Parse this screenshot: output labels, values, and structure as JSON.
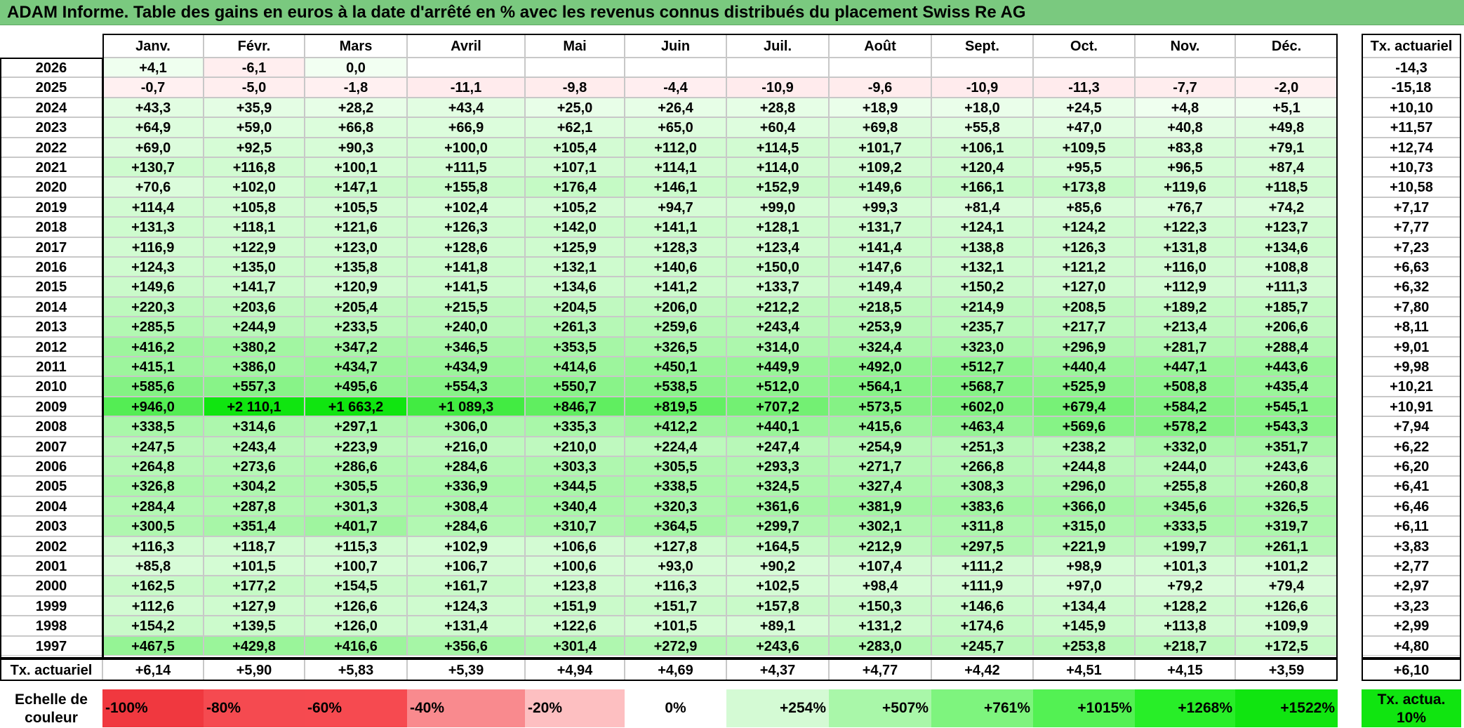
{
  "title": "ADAM Informe. Table des gains en euros à la date d'arrêté en % avec les revenus connus distribués du placement Swiss Re AG",
  "months": [
    "Janv.",
    "Févr.",
    "Mars",
    "Avril",
    "Mai",
    "Juin",
    "Juil.",
    "Août",
    "Sept.",
    "Oct.",
    "Nov.",
    "Déc."
  ],
  "rate_header": "Tx. actuariel",
  "rows": [
    {
      "year": "2026",
      "values": [
        "+4,1",
        "-6,1",
        "0,0",
        "",
        "",
        "",
        "",
        "",
        "",
        "",
        "",
        ""
      ],
      "rate": "-14,3"
    },
    {
      "year": "2025",
      "values": [
        "-0,7",
        "-5,0",
        "-1,8",
        "-11,1",
        "-9,8",
        "-4,4",
        "-10,9",
        "-9,6",
        "-10,9",
        "-11,3",
        "-7,7",
        "-2,0"
      ],
      "rate": "-15,18"
    },
    {
      "year": "2024",
      "values": [
        "+43,3",
        "+35,9",
        "+28,2",
        "+43,4",
        "+25,0",
        "+26,4",
        "+28,8",
        "+18,9",
        "+18,0",
        "+24,5",
        "+4,8",
        "+5,1"
      ],
      "rate": "+10,10"
    },
    {
      "year": "2023",
      "values": [
        "+64,9",
        "+59,0",
        "+66,8",
        "+66,9",
        "+62,1",
        "+65,0",
        "+60,4",
        "+69,8",
        "+55,8",
        "+47,0",
        "+40,8",
        "+49,8"
      ],
      "rate": "+11,57"
    },
    {
      "year": "2022",
      "values": [
        "+69,0",
        "+92,5",
        "+90,3",
        "+100,0",
        "+105,4",
        "+112,0",
        "+114,5",
        "+101,7",
        "+106,1",
        "+109,5",
        "+83,8",
        "+79,1"
      ],
      "rate": "+12,74"
    },
    {
      "year": "2021",
      "values": [
        "+130,7",
        "+116,8",
        "+100,1",
        "+111,5",
        "+107,1",
        "+114,1",
        "+114,0",
        "+109,2",
        "+120,4",
        "+95,5",
        "+96,5",
        "+87,4"
      ],
      "rate": "+10,73"
    },
    {
      "year": "2020",
      "values": [
        "+70,6",
        "+102,0",
        "+147,1",
        "+155,8",
        "+176,4",
        "+146,1",
        "+152,9",
        "+149,6",
        "+166,1",
        "+173,8",
        "+119,6",
        "+118,5"
      ],
      "rate": "+10,58"
    },
    {
      "year": "2019",
      "values": [
        "+114,4",
        "+105,8",
        "+105,5",
        "+102,4",
        "+105,2",
        "+94,7",
        "+99,0",
        "+99,3",
        "+81,4",
        "+85,6",
        "+76,7",
        "+74,2"
      ],
      "rate": "+7,17"
    },
    {
      "year": "2018",
      "values": [
        "+131,3",
        "+118,1",
        "+121,6",
        "+126,3",
        "+142,0",
        "+141,1",
        "+128,1",
        "+131,7",
        "+124,1",
        "+124,2",
        "+122,3",
        "+123,7"
      ],
      "rate": "+7,77"
    },
    {
      "year": "2017",
      "values": [
        "+116,9",
        "+122,9",
        "+123,0",
        "+128,6",
        "+125,9",
        "+128,3",
        "+123,4",
        "+141,4",
        "+138,8",
        "+126,3",
        "+131,8",
        "+134,6"
      ],
      "rate": "+7,23"
    },
    {
      "year": "2016",
      "values": [
        "+124,3",
        "+135,0",
        "+135,8",
        "+141,8",
        "+132,1",
        "+140,6",
        "+150,0",
        "+147,6",
        "+132,1",
        "+121,2",
        "+116,0",
        "+108,8"
      ],
      "rate": "+6,63"
    },
    {
      "year": "2015",
      "values": [
        "+149,6",
        "+141,7",
        "+120,9",
        "+141,5",
        "+134,6",
        "+141,2",
        "+133,7",
        "+149,4",
        "+150,2",
        "+127,0",
        "+112,9",
        "+111,3"
      ],
      "rate": "+6,32"
    },
    {
      "year": "2014",
      "values": [
        "+220,3",
        "+203,6",
        "+205,4",
        "+215,5",
        "+204,5",
        "+206,0",
        "+212,2",
        "+218,5",
        "+214,9",
        "+208,5",
        "+189,2",
        "+185,7"
      ],
      "rate": "+7,80"
    },
    {
      "year": "2013",
      "values": [
        "+285,5",
        "+244,9",
        "+233,5",
        "+240,0",
        "+261,3",
        "+259,6",
        "+243,4",
        "+253,9",
        "+235,7",
        "+217,7",
        "+213,4",
        "+206,6"
      ],
      "rate": "+8,11"
    },
    {
      "year": "2012",
      "values": [
        "+416,2",
        "+380,2",
        "+347,2",
        "+346,5",
        "+353,5",
        "+326,5",
        "+314,0",
        "+324,4",
        "+323,0",
        "+296,9",
        "+281,7",
        "+288,4"
      ],
      "rate": "+9,01"
    },
    {
      "year": "2011",
      "values": [
        "+415,1",
        "+386,0",
        "+434,7",
        "+434,9",
        "+414,6",
        "+450,1",
        "+449,9",
        "+492,0",
        "+512,7",
        "+440,4",
        "+447,1",
        "+443,6"
      ],
      "rate": "+9,98"
    },
    {
      "year": "2010",
      "values": [
        "+585,6",
        "+557,3",
        "+495,6",
        "+554,3",
        "+550,7",
        "+538,5",
        "+512,0",
        "+564,1",
        "+568,7",
        "+525,9",
        "+508,8",
        "+435,4"
      ],
      "rate": "+10,21"
    },
    {
      "year": "2009",
      "values": [
        "+946,0",
        "+2 110,1",
        "+1 663,2",
        "+1 089,3",
        "+846,7",
        "+819,5",
        "+707,2",
        "+573,5",
        "+602,0",
        "+679,4",
        "+584,2",
        "+545,1"
      ],
      "rate": "+10,91"
    },
    {
      "year": "2008",
      "values": [
        "+338,5",
        "+314,6",
        "+297,1",
        "+306,0",
        "+335,3",
        "+412,2",
        "+440,1",
        "+415,6",
        "+463,4",
        "+569,6",
        "+578,2",
        "+543,3"
      ],
      "rate": "+7,94"
    },
    {
      "year": "2007",
      "values": [
        "+247,5",
        "+243,4",
        "+223,9",
        "+216,0",
        "+210,0",
        "+224,4",
        "+247,4",
        "+254,9",
        "+251,3",
        "+238,2",
        "+332,0",
        "+351,7"
      ],
      "rate": "+6,22"
    },
    {
      "year": "2006",
      "values": [
        "+264,8",
        "+273,6",
        "+286,6",
        "+284,6",
        "+303,3",
        "+305,5",
        "+293,3",
        "+271,7",
        "+266,8",
        "+244,8",
        "+244,0",
        "+243,6"
      ],
      "rate": "+6,20"
    },
    {
      "year": "2005",
      "values": [
        "+326,8",
        "+304,2",
        "+305,5",
        "+336,9",
        "+344,5",
        "+338,5",
        "+324,5",
        "+327,4",
        "+308,3",
        "+296,0",
        "+255,8",
        "+260,8"
      ],
      "rate": "+6,41"
    },
    {
      "year": "2004",
      "values": [
        "+284,4",
        "+287,8",
        "+301,3",
        "+308,4",
        "+340,4",
        "+320,3",
        "+361,6",
        "+381,9",
        "+383,6",
        "+366,0",
        "+345,6",
        "+326,5"
      ],
      "rate": "+6,46"
    },
    {
      "year": "2003",
      "values": [
        "+300,5",
        "+351,4",
        "+401,7",
        "+284,6",
        "+310,7",
        "+364,5",
        "+299,7",
        "+302,1",
        "+311,8",
        "+315,0",
        "+333,5",
        "+319,7"
      ],
      "rate": "+6,11"
    },
    {
      "year": "2002",
      "values": [
        "+116,3",
        "+118,7",
        "+115,3",
        "+102,9",
        "+106,6",
        "+127,8",
        "+164,5",
        "+212,9",
        "+297,5",
        "+221,9",
        "+199,7",
        "+261,1"
      ],
      "rate": "+3,83"
    },
    {
      "year": "2001",
      "values": [
        "+85,8",
        "+101,5",
        "+100,7",
        "+106,7",
        "+100,6",
        "+93,0",
        "+90,2",
        "+107,4",
        "+111,2",
        "+98,9",
        "+101,3",
        "+101,2"
      ],
      "rate": "+2,77"
    },
    {
      "year": "2000",
      "values": [
        "+162,5",
        "+177,2",
        "+154,5",
        "+161,7",
        "+123,8",
        "+116,3",
        "+102,5",
        "+98,4",
        "+111,9",
        "+97,0",
        "+79,2",
        "+79,4"
      ],
      "rate": "+2,97"
    },
    {
      "year": "1999",
      "values": [
        "+112,6",
        "+127,9",
        "+126,6",
        "+124,3",
        "+151,9",
        "+151,7",
        "+157,8",
        "+150,3",
        "+146,6",
        "+134,4",
        "+128,2",
        "+126,6"
      ],
      "rate": "+3,23"
    },
    {
      "year": "1998",
      "values": [
        "+154,2",
        "+139,5",
        "+126,0",
        "+131,4",
        "+122,6",
        "+101,5",
        "+89,1",
        "+131,2",
        "+174,6",
        "+145,9",
        "+113,8",
        "+109,9"
      ],
      "rate": "+2,99"
    },
    {
      "year": "1997",
      "values": [
        "+467,5",
        "+429,8",
        "+416,6",
        "+356,6",
        "+301,4",
        "+272,9",
        "+243,6",
        "+283,0",
        "+245,7",
        "+253,8",
        "+218,7",
        "+172,5"
      ],
      "rate": "+4,80"
    }
  ],
  "footer": {
    "label": "Tx. actuariel",
    "values": [
      "+6,14",
      "+5,90",
      "+5,83",
      "+5,39",
      "+4,94",
      "+4,69",
      "+4,37",
      "+4,77",
      "+4,42",
      "+4,51",
      "+4,15",
      "+3,59"
    ],
    "rate": "+6,10"
  },
  "scale": {
    "label": "Echelle de couleur",
    "items": [
      {
        "text": "-100%",
        "color": "#f0383f"
      },
      {
        "text": "-80%",
        "color": "#f54a50"
      },
      {
        "text": "-60%",
        "color": "#f64a50"
      },
      {
        "text": "-40%",
        "color": "#f98a8e"
      },
      {
        "text": "-20%",
        "color": "#fdbfc1"
      },
      {
        "text": "0%",
        "color": "#ffffff"
      },
      {
        "text": "+254%",
        "color": "#d4fad4"
      },
      {
        "text": "+507%",
        "color": "#a9f7a9"
      },
      {
        "text": "+761%",
        "color": "#7ef47e"
      },
      {
        "text": "+1015%",
        "color": "#53f153"
      },
      {
        "text": "+1268%",
        "color": "#28ee28"
      },
      {
        "text": "+1522%",
        "color": "#10e510"
      }
    ],
    "rate_text": "Tx. actua. 10%",
    "rate_color": "#10e510"
  },
  "colors": {
    "title_bar": "#7ac97f",
    "grid_line": "#c8c8c8"
  }
}
